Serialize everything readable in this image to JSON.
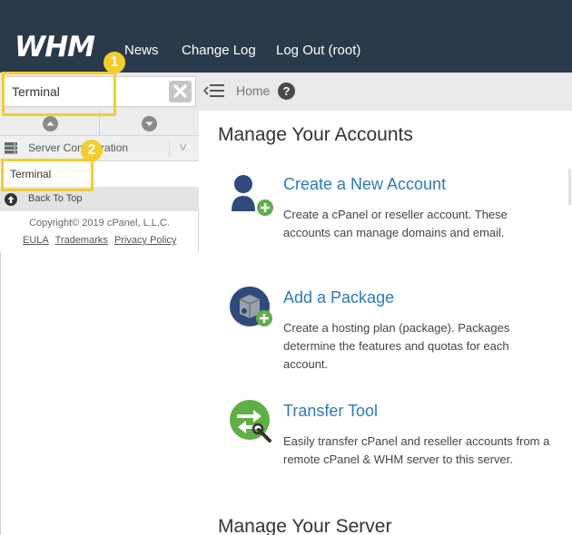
{
  "header": {
    "logo_text": "WHM",
    "nav": [
      "News",
      "Change Log",
      "Log Out (root)"
    ]
  },
  "search": {
    "value": "Terminal",
    "placeholder": ""
  },
  "breadcrumb": {
    "home": "Home",
    "help": "?"
  },
  "sidebar": {
    "category": "Server Configuration",
    "category_caret": "V",
    "result": "Terminal",
    "back_to_top": "Back To Top",
    "copyright": "Copyright© 2019 cPanel, L.L.C.",
    "footer_links": [
      "EULA",
      "Trademarks",
      "Privacy Policy"
    ]
  },
  "callouts": [
    "1",
    "2"
  ],
  "main": {
    "section1_title": "Manage Your Accounts",
    "section2_title": "Manage Your Server",
    "items": [
      {
        "title": "Create a New Account",
        "description": "Create a cPanel or reseller account. These accounts can manage domains and email."
      },
      {
        "title": "Add a Package",
        "description": "Create a hosting plan (package). Packages determine the features and quotas for each account."
      },
      {
        "title": "Transfer Tool",
        "description": "Easily transfer cPanel and reseller accounts from a remote cPanel & WHM server to this server."
      }
    ]
  },
  "colors": {
    "header_bg": "#293a4a",
    "link_blue": "#2b7ab8",
    "highlight_yellow": "#f3cd2c",
    "green": "#5fae46"
  }
}
